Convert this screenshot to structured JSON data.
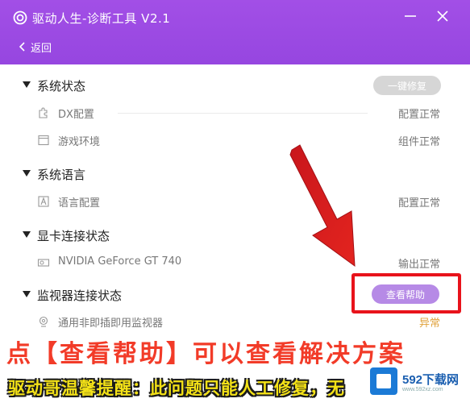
{
  "window": {
    "title": "驱动人生-诊断工具 V2.1",
    "back_label": "返回",
    "accent_color": "#9a48e2"
  },
  "sections": [
    {
      "label": "系统状态",
      "action_label": "一键修复",
      "rows": [
        {
          "icon": "puzzle-icon",
          "label": "DX配置",
          "status": "配置正常"
        },
        {
          "icon": "window-icon",
          "label": "游戏环境",
          "status": "组件正常"
        }
      ]
    },
    {
      "label": "系统语言",
      "rows": [
        {
          "icon": "font-icon",
          "label": "语言配置",
          "status": "配置正常"
        }
      ]
    },
    {
      "label": "显卡连接状态",
      "rows": [
        {
          "icon": "gpu-icon",
          "label": "NVIDIA GeForce GT 740",
          "status": "输出正常"
        }
      ]
    },
    {
      "label": "监视器连接状态",
      "action_label": "查看帮助",
      "rows": [
        {
          "icon": "webcam-icon",
          "label": "通用非即插即用监视器",
          "status": "异常"
        }
      ]
    }
  ],
  "overlay": {
    "caption_main": "点【查看帮助】可以查看解决方案",
    "caption_sub": "驱动哥温馨提醒：此问题只能人工修复，无",
    "highlight_color": "#e8131b"
  },
  "watermark": {
    "brand": "592下载网",
    "url": "www.592xz.com"
  }
}
